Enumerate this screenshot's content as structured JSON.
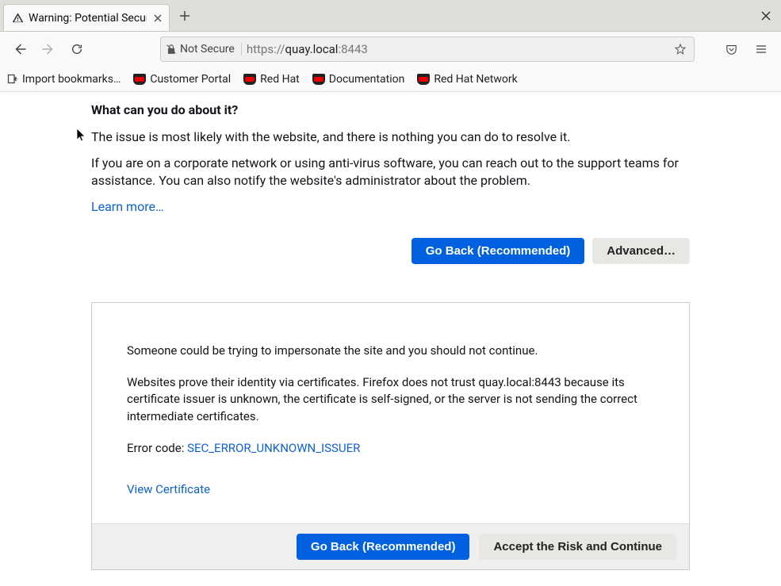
{
  "tab": {
    "title": "Warning: Potential Securi"
  },
  "urlbar": {
    "not_secure_label": "Not Secure",
    "protocol": "https://",
    "host": "quay.local",
    "port": ":8443"
  },
  "bookmarks": {
    "import": "Import bookmarks…",
    "items": [
      "Customer Portal",
      "Red Hat",
      "Documentation",
      "Red Hat Network"
    ]
  },
  "page": {
    "heading": "What can you do about it?",
    "p1": "The issue is most likely with the website, and there is nothing you can do to resolve it.",
    "p2": "If you are on a corporate network or using anti-virus software, you can reach out to the support teams for assistance. You can also notify the website's administrator about the problem.",
    "learn_more": "Learn more…",
    "go_back": "Go Back (Recommended)",
    "advanced": "Advanced…"
  },
  "advanced_panel": {
    "p1": "Someone could be trying to impersonate the site and you should not continue.",
    "p2": "Websites prove their identity via certificates. Firefox does not trust quay.local:8443 because its certificate issuer is unknown, the certificate is self-signed, or the server is not sending the correct intermediate certificates.",
    "error_label": "Error code: ",
    "error_code": "SEC_ERROR_UNKNOWN_ISSUER",
    "view_cert": "View Certificate",
    "go_back": "Go Back (Recommended)",
    "accept": "Accept the Risk and Continue"
  }
}
